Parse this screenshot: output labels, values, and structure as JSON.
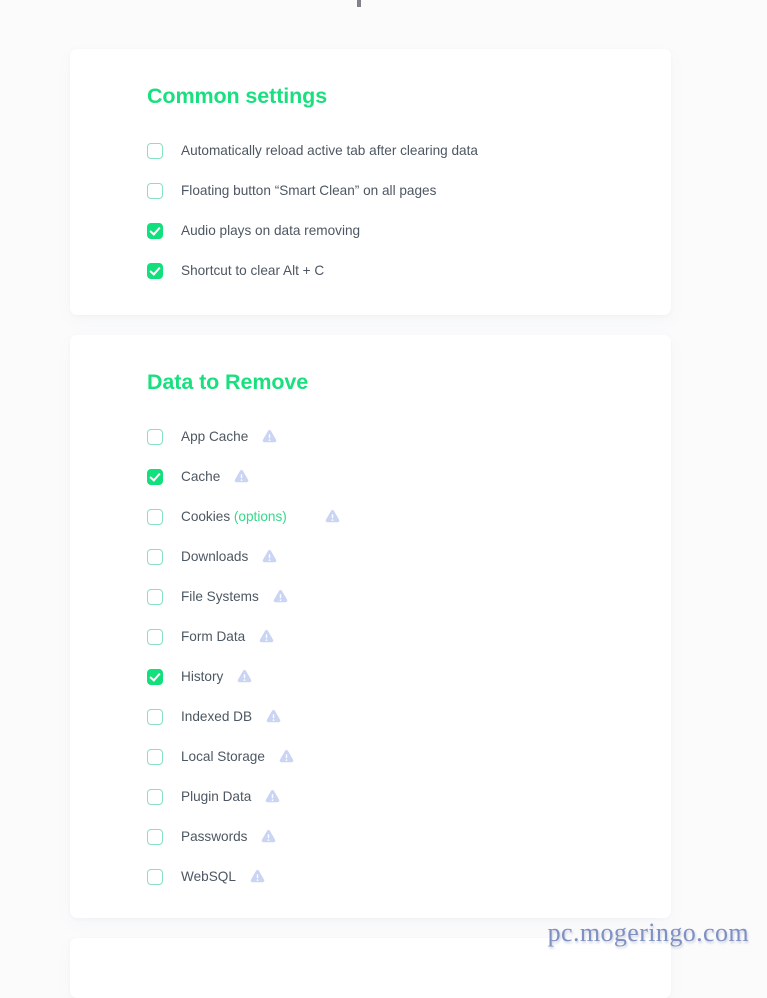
{
  "watermark": "pc.mogeringo.com",
  "colors": {
    "accent_green": "#19e07f",
    "checkbox_checked": "#12e07d",
    "checkbox_border": "#86e2bf",
    "label_text": "#4d5762",
    "sub_link_green": "#35d98a",
    "warn_icon": "#c9d5f2",
    "page_background": "#fbfbfc",
    "card_background": "#ffffff"
  },
  "common_settings": {
    "title": "Common settings",
    "items": [
      {
        "label": "Automatically reload active tab after clearing data",
        "checked": false,
        "info": false
      },
      {
        "label": "Floating button “Smart Clean” on all pages",
        "checked": false,
        "info": false
      },
      {
        "label": "Audio plays on data removing",
        "checked": true,
        "info": false
      },
      {
        "label": "Shortcut to clear Alt + C",
        "checked": true,
        "info": false
      }
    ]
  },
  "data_to_remove": {
    "title": "Data to Remove",
    "items": [
      {
        "label": "App Cache",
        "sub": "",
        "checked": false,
        "info": true,
        "info_gap": "normal"
      },
      {
        "label": "Cache",
        "sub": "",
        "checked": true,
        "info": true,
        "info_gap": "normal"
      },
      {
        "label": "Cookies",
        "sub": "(options)",
        "checked": false,
        "info": true,
        "info_gap": "wide"
      },
      {
        "label": "Downloads",
        "sub": "",
        "checked": false,
        "info": true,
        "info_gap": "normal"
      },
      {
        "label": "File Systems",
        "sub": "",
        "checked": false,
        "info": true,
        "info_gap": "normal"
      },
      {
        "label": "Form Data",
        "sub": "",
        "checked": false,
        "info": true,
        "info_gap": "normal"
      },
      {
        "label": "History",
        "sub": "",
        "checked": true,
        "info": true,
        "info_gap": "normal"
      },
      {
        "label": "Indexed DB",
        "sub": "",
        "checked": false,
        "info": true,
        "info_gap": "normal"
      },
      {
        "label": "Local Storage",
        "sub": "",
        "checked": false,
        "info": true,
        "info_gap": "normal"
      },
      {
        "label": "Plugin Data",
        "sub": "",
        "checked": false,
        "info": true,
        "info_gap": "normal"
      },
      {
        "label": "Passwords",
        "sub": "",
        "checked": false,
        "info": true,
        "info_gap": "normal"
      },
      {
        "label": "WebSQL",
        "sub": "",
        "checked": false,
        "info": true,
        "info_gap": "normal"
      }
    ]
  },
  "icons": {
    "warning": "warning-triangle-icon",
    "checkmark": "checkmark-icon"
  }
}
